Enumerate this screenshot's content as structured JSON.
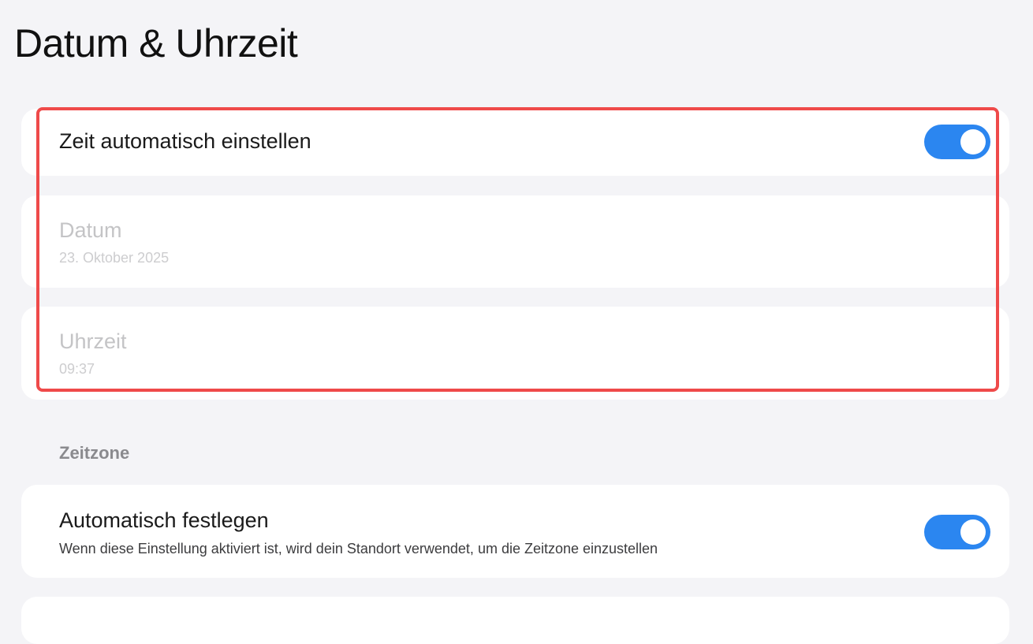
{
  "page": {
    "title": "Datum & Uhrzeit"
  },
  "auto_time": {
    "label": "Zeit automatisch einstellen",
    "enabled": true,
    "state": "on"
  },
  "date": {
    "label": "Datum",
    "value": "23. Oktober 2025",
    "disabled": true
  },
  "time": {
    "label": "Uhrzeit",
    "value": "09:37",
    "disabled": true
  },
  "timezone_section": {
    "header": "Zeitzone",
    "auto_zone": {
      "label": "Automatisch festlegen",
      "description": "Wenn diese Einstellung aktiviert ist, wird dein Standort verwendet, um die Zeitzone einzustellen",
      "enabled": true,
      "state": "on"
    }
  },
  "colors": {
    "accent": "#2b86f0",
    "highlight": "#ef4a4a",
    "background": "#f4f4f7",
    "card": "#ffffff",
    "disabled_text": "#c4c4c6"
  },
  "icons": {
    "toggle": "toggle-switch-icon"
  }
}
